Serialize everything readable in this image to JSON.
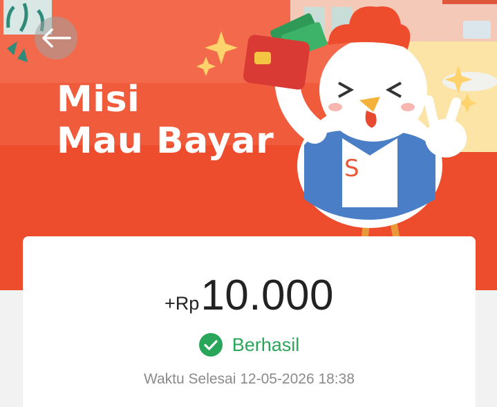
{
  "banner": {
    "title_line1": "Misi",
    "title_line2": "Mau Bayar",
    "background_color": "#ee4d2d",
    "mascot_shirt_letter": "S"
  },
  "navigation": {
    "back_icon": "arrow-left-icon"
  },
  "reward": {
    "currency_prefix": "+Rp",
    "amount": "10.000",
    "status_label": "Berhasil",
    "status_icon": "check-circle-icon",
    "status_color": "#2aa65a",
    "finish_time": "Waktu Selesai 12-05-2026 18:38"
  }
}
